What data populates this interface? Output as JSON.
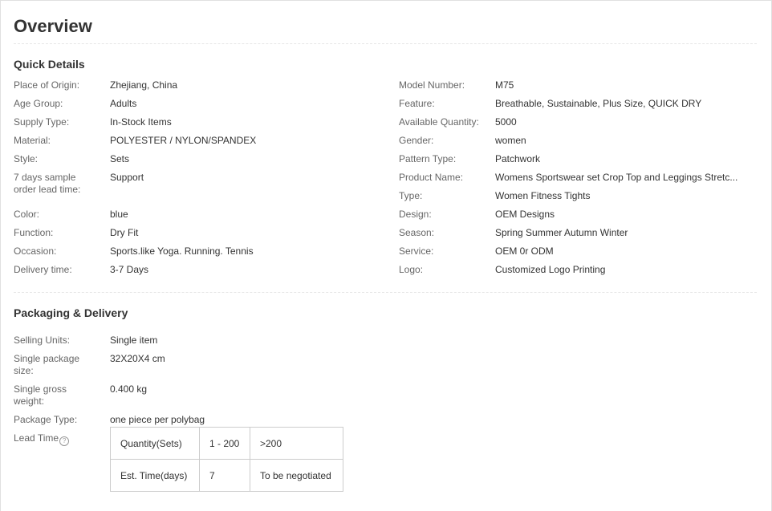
{
  "title": "Overview",
  "quick_details": {
    "title": "Quick Details",
    "left": [
      {
        "label": "Place of Origin:",
        "value": "Zhejiang, China"
      },
      {
        "label": "Age Group:",
        "value": "Adults"
      },
      {
        "label": "Supply Type:",
        "value": "In-Stock Items"
      },
      {
        "label": "Material:",
        "value": "POLYESTER / NYLON/SPANDEX"
      },
      {
        "label": "Style:",
        "value": "Sets"
      },
      {
        "label": "7 days sample order lead time:",
        "value": "Support"
      },
      {
        "label": "Color:",
        "value": "blue"
      },
      {
        "label": "Function:",
        "value": "Dry Fit"
      },
      {
        "label": "Occasion:",
        "value": "Sports.like Yoga. Running. Tennis"
      },
      {
        "label": "Delivery time:",
        "value": "3-7 Days"
      }
    ],
    "right": [
      {
        "label": "Model Number:",
        "value": "M75"
      },
      {
        "label": "Feature:",
        "value": "Breathable, Sustainable, Plus Size, QUICK DRY"
      },
      {
        "label": "Available Quantity:",
        "value": "5000"
      },
      {
        "label": "Gender:",
        "value": "women"
      },
      {
        "label": "Pattern Type:",
        "value": "Patchwork"
      },
      {
        "label": "Product Name:",
        "value": "Womens Sportswear set Crop Top and Leggings Stretc..."
      },
      {
        "label": "Type:",
        "value": "Women Fitness Tights"
      },
      {
        "label": "Design:",
        "value": "OEM Designs"
      },
      {
        "label": "Season:",
        "value": "Spring Summer Autumn Winter"
      },
      {
        "label": "Service:",
        "value": "OEM 0r ODM"
      },
      {
        "label": "Logo:",
        "value": "Customized Logo Printing"
      }
    ]
  },
  "packaging": {
    "title": "Packaging & Delivery",
    "rows": [
      {
        "label": "Selling Units:",
        "value": "Single item"
      },
      {
        "label": "Single package size:",
        "value": "32X20X4 cm"
      },
      {
        "label": "Single gross weight:",
        "value": "0.400 kg"
      },
      {
        "label": "Package Type:",
        "value": "one piece per polybag"
      }
    ],
    "lead_time_label": "Lead Time",
    "lead_time_help_glyph": "?",
    "lead_table": {
      "row1": [
        "Quantity(Sets)",
        "1 - 200",
        ">200"
      ],
      "row2": [
        "Est. Time(days)",
        "7",
        "To be negotiated"
      ]
    }
  }
}
